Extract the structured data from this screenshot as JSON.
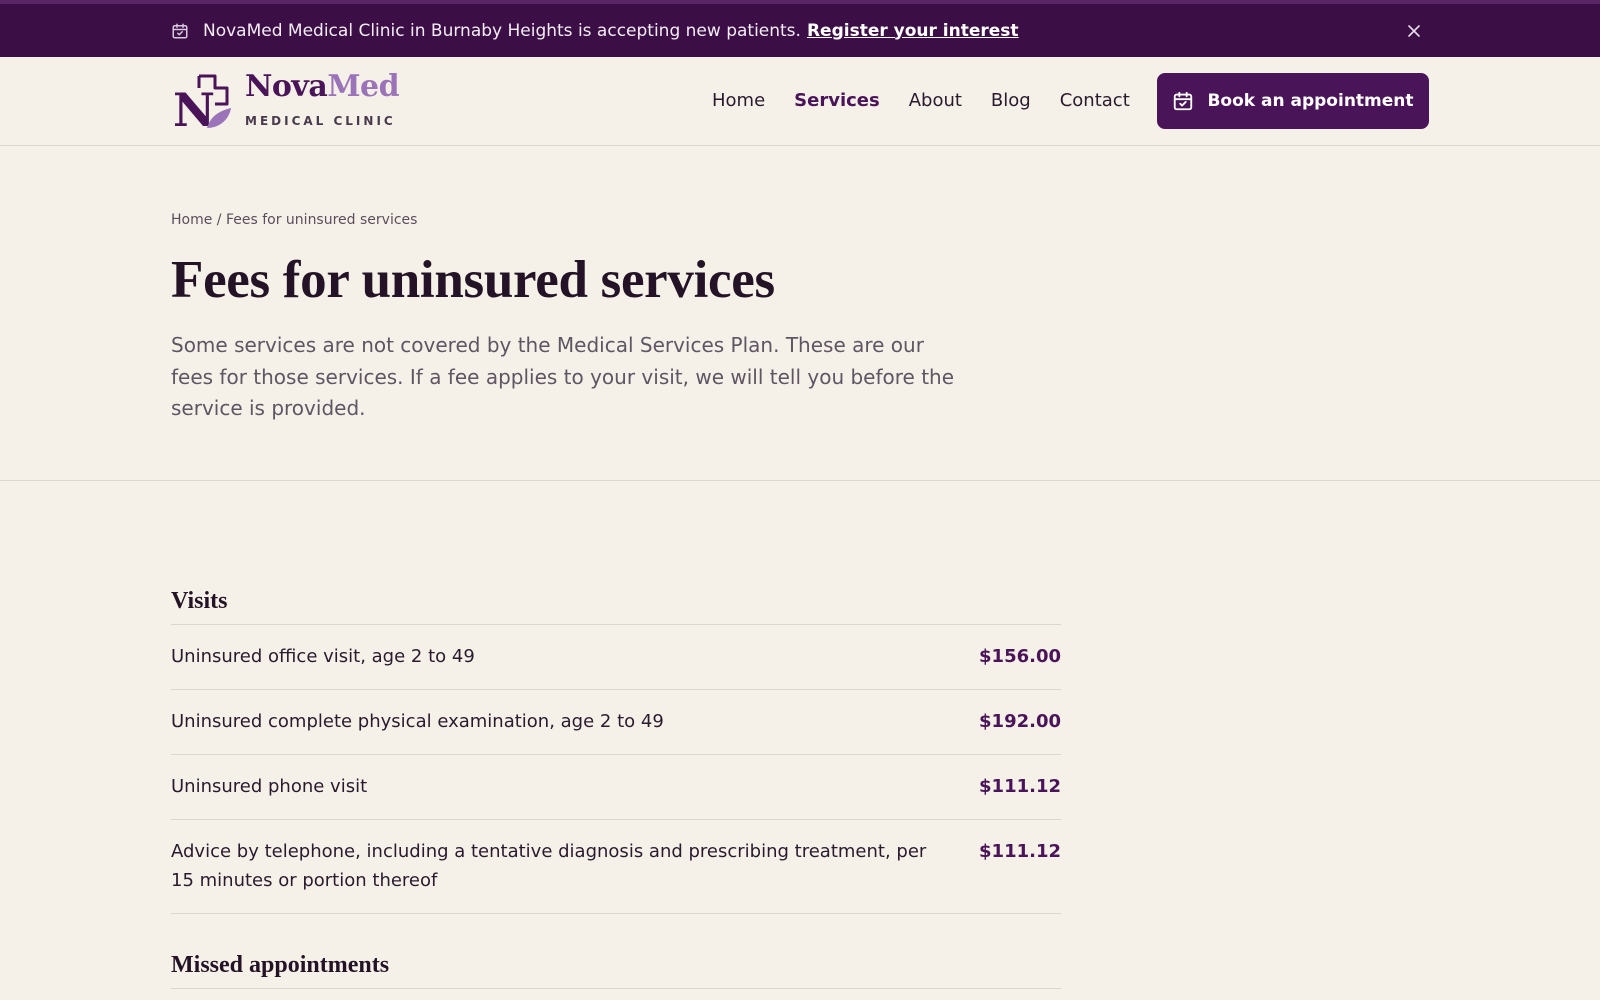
{
  "announcement": {
    "text": "NovaMed Medical Clinic in Burnaby Heights is accepting new patients.",
    "link": "Register your interest",
    "icon": "calendar-check-icon",
    "close_icon": "close-icon"
  },
  "header": {
    "logo_nova": "Nova",
    "logo_med": "Med",
    "logo_sub": "MEDICAL CLINIC",
    "nav": [
      {
        "label": "Home",
        "active": false
      },
      {
        "label": "Services",
        "active": true
      },
      {
        "label": "About",
        "active": false
      },
      {
        "label": "Blog",
        "active": false
      },
      {
        "label": "Contact",
        "active": false
      }
    ],
    "book_label": "Book an appointment",
    "book_icon": "calendar-check-icon"
  },
  "page": {
    "breadcrumb_home": "Home",
    "breadcrumb_sep": " / ",
    "breadcrumb_current": "Fees for uninsured services",
    "title": "Fees for uninsured services",
    "intro": "Some services are not covered by the Medical Services Plan. These are our fees for those services. If a fee applies to your visit, we will tell you before the service is provided."
  },
  "fees": {
    "sections": [
      {
        "title": "Visits",
        "rows": [
          {
            "name": "Uninsured office visit, age 2 to 49",
            "price": "$156.00"
          },
          {
            "name": "Uninsured complete physical examination, age 2 to 49",
            "price": "$192.00"
          },
          {
            "name": "Uninsured phone visit",
            "price": "$111.12"
          },
          {
            "name": "Advice by telephone, including a tentative diagnosis and prescribing treatment, per 15 minutes or portion thereof",
            "price": "$111.12"
          }
        ]
      },
      {
        "title": "Missed appointments",
        "rows": []
      }
    ]
  },
  "colors": {
    "brand": "#4a1458",
    "brand_light": "#9a73b8",
    "banner": "#3b0f45",
    "background": "#f6f1e8"
  }
}
